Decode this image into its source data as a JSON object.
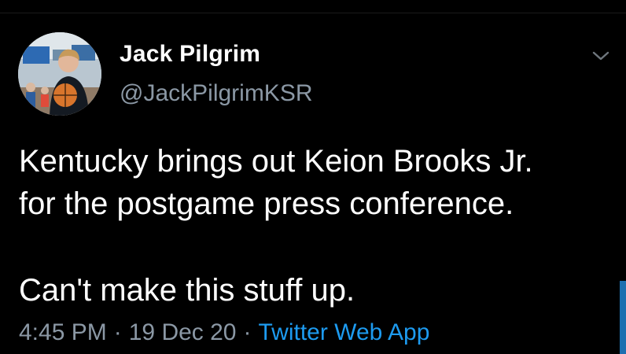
{
  "author": {
    "display_name": "Jack Pilgrim",
    "handle": "@JackPilgrimKSR",
    "avatar_icon": "profile-photo-basketball"
  },
  "tweet": {
    "line1": "Kentucky brings out Keion Brooks Jr.",
    "line2": "for the postgame press conference.",
    "line3": "Can't make this stuff up."
  },
  "meta": {
    "time": "4:45 PM",
    "separator": "·",
    "date": "19 Dec 20",
    "source": "Twitter Web App"
  },
  "icons": {
    "menu": "chevron-down-icon"
  },
  "colors": {
    "background": "#000000",
    "text": "#ffffff",
    "secondary": "#8b98a5",
    "link": "#1d9bf0"
  }
}
